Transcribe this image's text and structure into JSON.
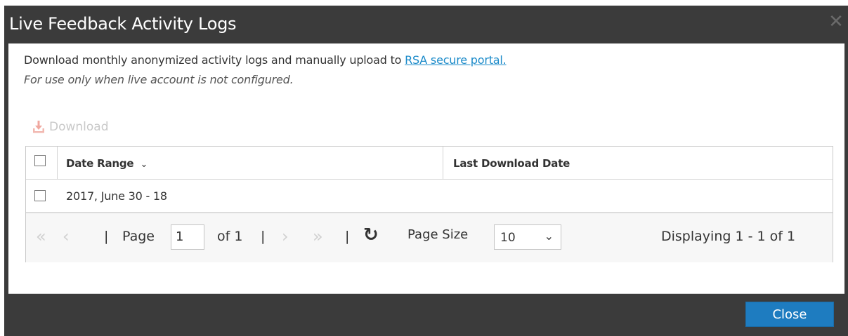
{
  "dialog": {
    "title": "Live Feedback Activity Logs",
    "close_icon": "close-icon"
  },
  "content": {
    "description_prefix": "Download monthly anonymized activity logs and manually upload to ",
    "portal_link": "RSA secure portal.",
    "note": "For use only when live account is not configured."
  },
  "toolbar": {
    "download_label": "Download",
    "download_icon": "download-icon",
    "download_enabled": false
  },
  "grid": {
    "columns": [
      {
        "label": "Date Range",
        "sort_icon": "chevron-down-icon"
      },
      {
        "label": "Last Download Date"
      }
    ],
    "rows": [
      {
        "date_range": "2017, June 30 - 18",
        "last_download_date": "",
        "checked": false
      }
    ]
  },
  "pager": {
    "page_label": "Page",
    "page_value": "1",
    "of_label": "of 1",
    "page_size_label": "Page Size",
    "page_size_value": "10",
    "displaying": "Displaying 1 - 1 of 1",
    "separator": "|"
  },
  "footer": {
    "close_label": "Close"
  },
  "colors": {
    "titlebar": "#3b3b3b",
    "link": "#1a8ac9",
    "primary_button": "#1e7cc0",
    "disabled_icon": "#f0a8a0"
  }
}
